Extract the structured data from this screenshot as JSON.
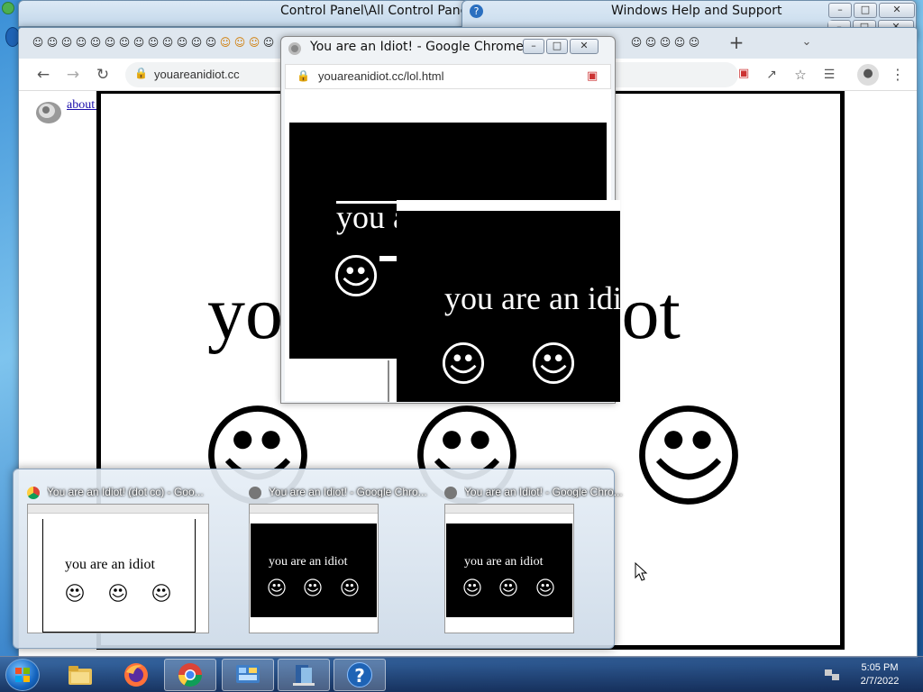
{
  "back_windows": {
    "control_panel_title": "Control Panel\\All Control Panel",
    "help_title": "Windows Help and Support"
  },
  "main_window": {
    "tab_icon": "troll-face-favicon",
    "new_tab_label": "+",
    "url": "youareanidiot.cc"
  },
  "page": {
    "about_flash": "about flash",
    "big_text": "you are an idiot",
    "smiley_icon": "smiley-face-icon"
  },
  "popup": {
    "title": "You are an Idiot! - Google Chrome",
    "url": "youareanidiot.cc/lol.html",
    "text_1": "you are an idiot",
    "text_2": "you are an idiot"
  },
  "preview": {
    "items": [
      {
        "title": "You are an Idiot! (dot cc) - Goo...",
        "thumb_text": "you are an idiot",
        "theme": "white"
      },
      {
        "title": "You are an Idiot! - Google Chro...",
        "thumb_text": "you are an idiot",
        "theme": "black"
      },
      {
        "title": "You are an Idiot! - Google Chro...",
        "thumb_text": "you are an idiot",
        "theme": "black"
      }
    ]
  },
  "taskbar": {
    "apps": [
      "file-explorer",
      "firefox",
      "chrome",
      "control-panel",
      "window-switcher",
      "help"
    ],
    "help_label": "?",
    "time": "5:05 PM",
    "date": "2/7/2022"
  },
  "colors": {
    "desktop": "#3a8fd6",
    "link": "#1a0dab",
    "taskbar": "#1b3a6e"
  }
}
